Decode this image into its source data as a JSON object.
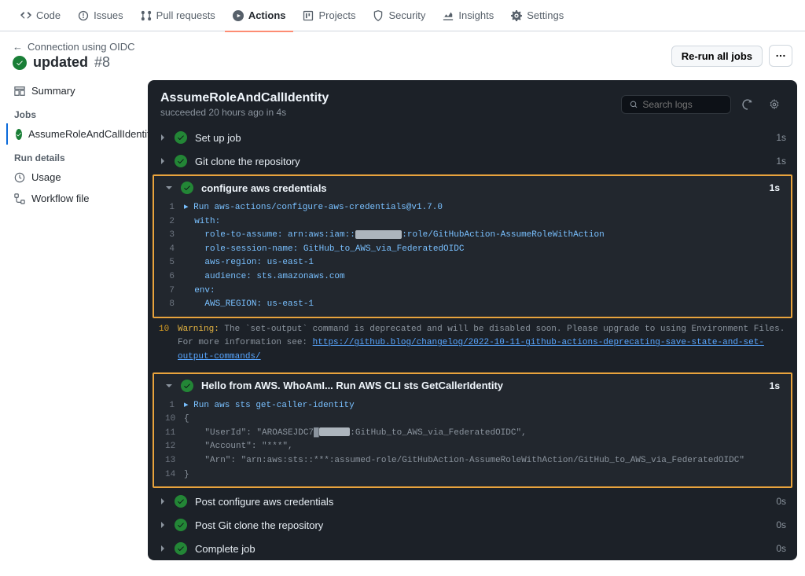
{
  "nav": {
    "code": "Code",
    "issues": "Issues",
    "pulls": "Pull requests",
    "actions": "Actions",
    "projects": "Projects",
    "security": "Security",
    "insights": "Insights",
    "settings": "Settings"
  },
  "header": {
    "back_link": "Connection using OIDC",
    "workflow_title": "updated",
    "workflow_number": "#8",
    "rerun_label": "Re-run all jobs"
  },
  "sidebar": {
    "summary": "Summary",
    "jobs_heading": "Jobs",
    "job_name": "AssumeRoleAndCallIdentity",
    "rundetails_heading": "Run details",
    "usage": "Usage",
    "workflow_file": "Workflow file"
  },
  "log": {
    "job_title": "AssumeRoleAndCallIdentity",
    "job_sub_prefix": "succeeded ",
    "job_sub_time": "20 hours ago",
    "job_sub_in": " in 4s",
    "search_placeholder": "Search logs"
  },
  "steps": {
    "setup": {
      "name": "Set up job",
      "time": "1s"
    },
    "clone": {
      "name": "Git clone the repository",
      "time": "1s"
    },
    "configure": {
      "name": "configure aws credentials",
      "time": "1s",
      "lines": [
        {
          "n": "1",
          "t": "▸ Run aws-actions/configure-aws-credentials@v1.7.0",
          "cls": "lt-cmd"
        },
        {
          "n": "2",
          "t": "  with:",
          "cls": "lt-cmd"
        },
        {
          "n": "3",
          "pre": "    role-to-assume: arn:aws:iam::",
          "censor": "█████████",
          "post": ":role/GitHubAction-AssumeRoleWithAction",
          "cls": "lt-cmd"
        },
        {
          "n": "4",
          "t": "    role-session-name: GitHub_to_AWS_via_FederatedOIDC",
          "cls": "lt-cmd"
        },
        {
          "n": "5",
          "t": "    aws-region: us-east-1",
          "cls": "lt-cmd"
        },
        {
          "n": "6",
          "t": "    audience: sts.amazonaws.com",
          "cls": "lt-cmd"
        },
        {
          "n": "7",
          "t": "  env:",
          "cls": "lt-cmd"
        },
        {
          "n": "8",
          "t": "    AWS_REGION: us-east-1",
          "cls": "lt-cmd"
        }
      ],
      "warning": {
        "n": "10",
        "prefix": "Warning: ",
        "text": "The `set-output` command is deprecated and will be disabled soon. Please upgrade to using Environment Files. For more information see: ",
        "link": "https://github.blog/changelog/2022-10-11-github-actions-deprecating-save-state-and-set-output-commands/"
      }
    },
    "hello": {
      "name": "Hello from AWS. WhoAmI... Run AWS CLI sts GetCallerIdentity",
      "time": "1s",
      "lines": [
        {
          "n": "1",
          "t": "▸ Run aws sts get-caller-identity",
          "cls": "lt-cmd"
        },
        {
          "n": "10",
          "t": "{",
          "cls": "lt-key"
        },
        {
          "n": "11",
          "pre": "    \"UserId\": \"AROASEJDC7█",
          "censor": "██████",
          "post": ":GitHub_to_AWS_via_FederatedOIDC\",",
          "cls": "lt-key"
        },
        {
          "n": "12",
          "t": "    \"Account\": \"***\",",
          "cls": "lt-key"
        },
        {
          "n": "13",
          "t": "    \"Arn\": \"arn:aws:sts::***:assumed-role/GitHubAction-AssumeRoleWithAction/GitHub_to_AWS_via_FederatedOIDC\"",
          "cls": "lt-key"
        },
        {
          "n": "14",
          "t": "}",
          "cls": "lt-key"
        }
      ]
    },
    "post_configure": {
      "name": "Post configure aws credentials",
      "time": "0s"
    },
    "post_clone": {
      "name": "Post Git clone the repository",
      "time": "0s"
    },
    "complete": {
      "name": "Complete job",
      "time": "0s"
    }
  }
}
